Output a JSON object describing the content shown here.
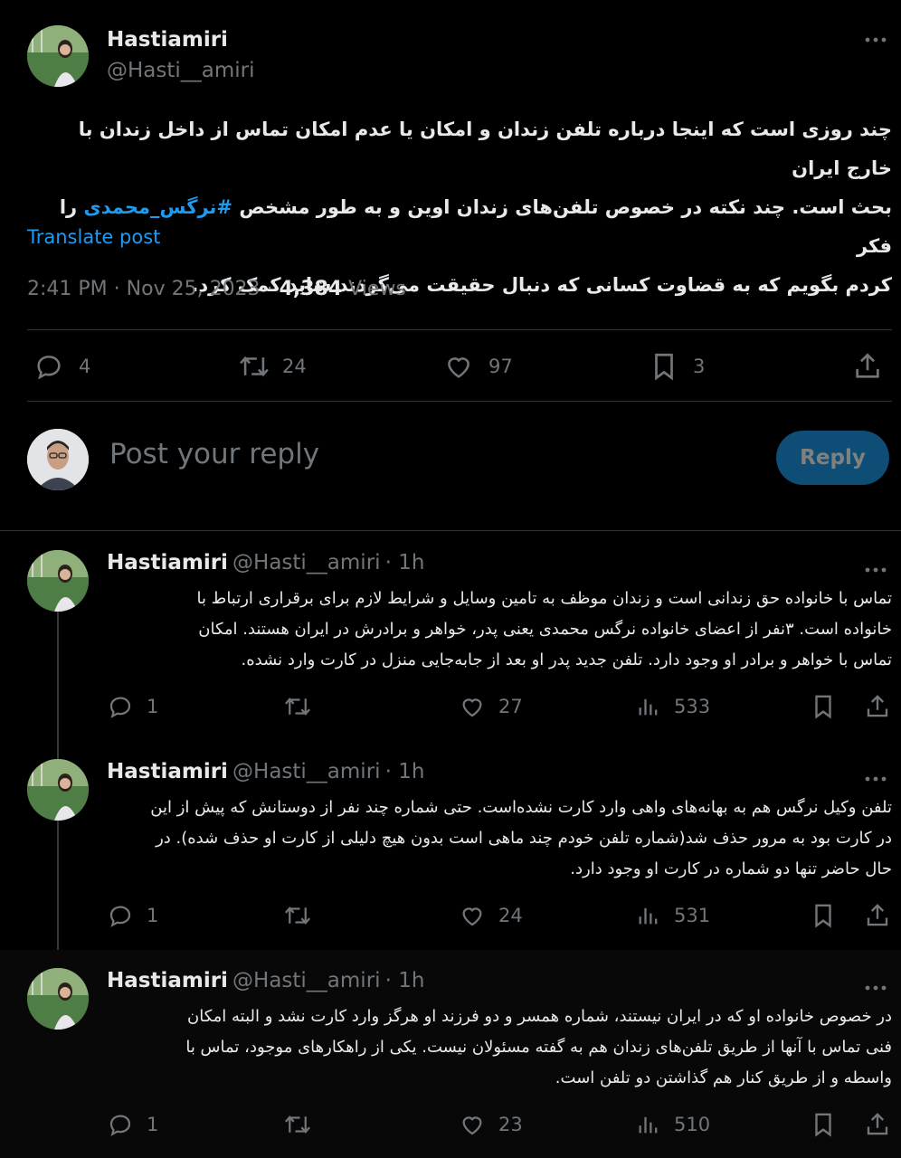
{
  "main_post": {
    "author_name": "Hastiamiri",
    "author_handle": "@Hasti__amiri",
    "text_line1": "چند روزی است که اینجا درباره تلفن زندان و امکان یا عدم امکان تماس از داخل زندان با خارج ایران",
    "text_line2_pre": "بحث است. چند نکته در خصوص تلفن‌های زندان اوین و به طور مشخص",
    "hashtag": "#نرگس_محمدی",
    "text_line2_post": "را فکر",
    "text_line3": "کردم بگویم که به قضاوت کسانی که دنبال حقیقت می‌گردند شاید کمک کرد.",
    "translate_label": "Translate post",
    "time": "2:41 PM",
    "sep1": "·",
    "date": "Nov 25, 2023",
    "sep2": "·",
    "views_count": "4,384",
    "views_label": "Views",
    "stats": {
      "replies": "4",
      "reposts": "24",
      "likes": "97",
      "bookmarks": "3"
    }
  },
  "compose": {
    "placeholder": "Post your reply",
    "button_label": "Reply"
  },
  "replies": [
    {
      "name": "Hastiamiri",
      "handle": "@Hasti__amiri",
      "time": "· 1h",
      "lines": [
        "تماس با خانواده حق زندانی است و زندان موظف به تامین وسایل و شرایط لازم برای برقراری ارتباط با",
        "خانواده است. ۳نفر از اعضای خانواده نرگس محمدی یعنی پدر، خواهر و برادرش در ایران هستند. امکان",
        "تماس با خواهر و برادر او وجود دارد. تلفن جدید پدر او بعد از جابه‌جایی منزل در کارت وارد نشده."
      ],
      "stats": {
        "replies": "1",
        "likes": "27",
        "views": "533"
      }
    },
    {
      "name": "Hastiamiri",
      "handle": "@Hasti__amiri",
      "time": "· 1h",
      "lines": [
        "تلفن وکیل نرگس هم به بهانه‌های واهی وارد کارت نشده‌است. حتی شماره چند نفر از دوستانش که پیش از این",
        "در کارت بود به مرور حذف شد(شماره تلفن خودم چند ماهی است بدون هیچ دلیلی از کارت او حذف شده). در",
        "حال حاضر تنها دو شماره در کارت او وجود دارد."
      ],
      "stats": {
        "replies": "1",
        "likes": "24",
        "views": "531"
      }
    },
    {
      "name": "Hastiamiri",
      "handle": "@Hasti__amiri",
      "time": "· 1h",
      "lines": [
        "در خصوص خانواده او که در ایران نیستند، شماره همسر و دو فرزند او هرگز وارد کارت نشد و البته امکان",
        "فنی تماس با آنها از طریق تلفن‌های زندان هم به گفته مسئولان  نیست. یکی از راهکارهای موجود، تماس با",
        "واسطه و از طریق کنار هم گذاشتن دو تلفن است."
      ],
      "stats": {
        "replies": "1",
        "likes": "23",
        "views": "510"
      }
    }
  ],
  "colors": {
    "accent": "#1d9bf0",
    "reply_button_bg": "#1a8cd8",
    "muted": "#71767b",
    "divider": "#2f3336"
  },
  "icons": [
    "more-icon",
    "reply-icon",
    "repost-icon",
    "like-icon",
    "bookmark-icon",
    "share-icon",
    "views-icon"
  ]
}
